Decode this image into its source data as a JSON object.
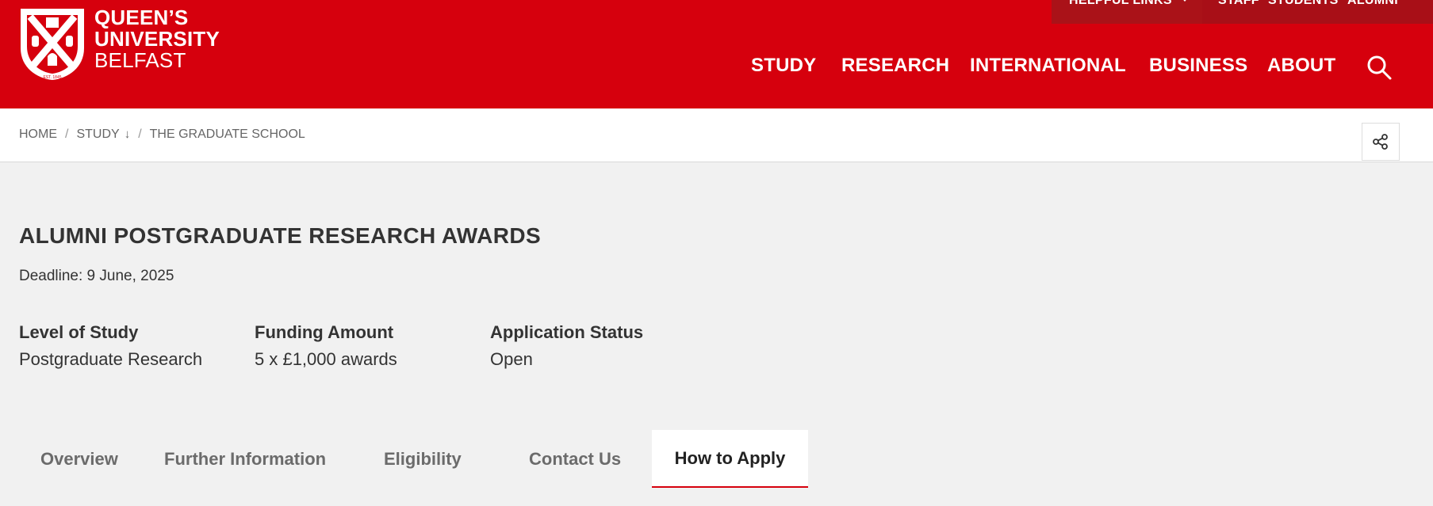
{
  "header": {
    "logo": {
      "line1": "QUEEN’S",
      "line2": "UNIVERSITY",
      "line3": "BELFAST",
      "crest_text": "EST. 1845"
    },
    "utility": {
      "helpful_links": "HELPFUL LINKS",
      "staff": "STAFF",
      "students": "STUDENTS",
      "alumni": "ALUMNI"
    },
    "nav": [
      "STUDY",
      "RESEARCH",
      "INTERNATIONAL",
      "BUSINESS",
      "ABOUT"
    ],
    "colors": {
      "brand_red": "#d6000d",
      "utility_red": "#a80f17"
    }
  },
  "breadcrumb": {
    "home": "HOME",
    "study": "STUDY",
    "study_arrow": "↓",
    "current": "THE GRADUATE SCHOOL",
    "separator": "/"
  },
  "icons": {
    "search": "search-icon",
    "share": "share-icon",
    "caret": "caret-down-icon"
  },
  "page": {
    "title": "ALUMNI POSTGRADUATE RESEARCH AWARDS",
    "deadline": "Deadline: 9 June, 2025",
    "meta": [
      {
        "label": "Level of Study",
        "value": "Postgraduate Research"
      },
      {
        "label": "Funding Amount",
        "value": "5 x £1,000 awards"
      },
      {
        "label": "Application Status",
        "value": "Open"
      }
    ]
  },
  "tabs": [
    {
      "label": "Overview",
      "active": false
    },
    {
      "label": "Further Information",
      "active": false
    },
    {
      "label": "Eligibility",
      "active": false
    },
    {
      "label": "Contact Us",
      "active": false
    },
    {
      "label": "How to Apply",
      "active": true
    }
  ]
}
